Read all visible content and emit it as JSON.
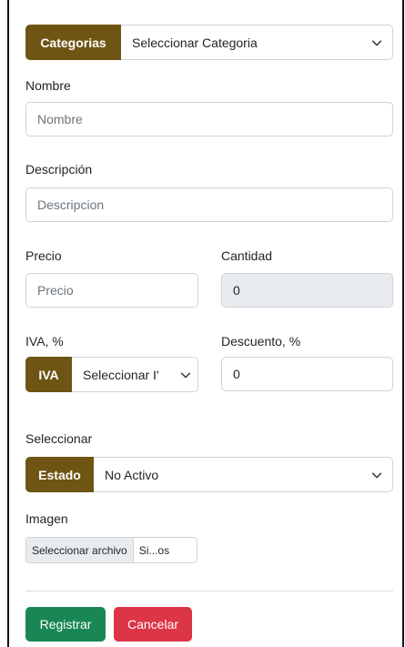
{
  "categoria": {
    "addon": "Categorias",
    "selected": "Seleccionar Categoria"
  },
  "nombre": {
    "label": "Nombre",
    "placeholder": "Nombre"
  },
  "descripcion": {
    "label": "Descripción",
    "placeholder": "Descripcion"
  },
  "precio": {
    "label": "Precio",
    "placeholder": "Precio"
  },
  "cantidad": {
    "label": "Cantidad",
    "value": "0"
  },
  "iva": {
    "label": "IVA, %",
    "addon": "IVA",
    "selected": "Seleccionar I'"
  },
  "descuento": {
    "label": "Descuento, %",
    "value": "0"
  },
  "estado": {
    "label": "Seleccionar",
    "addon": "Estado",
    "selected": "No Activo"
  },
  "imagen": {
    "label": "Imagen",
    "button": "Seleccionar archivo",
    "filename": "Si...os"
  },
  "actions": {
    "register": "Registrar",
    "cancel": "Cancelar"
  },
  "colors": {
    "addon": "#6f5513",
    "primary": "#198754",
    "danger": "#dc3545"
  },
  "icons": {
    "select_chevron": "chevron-down-icon"
  }
}
